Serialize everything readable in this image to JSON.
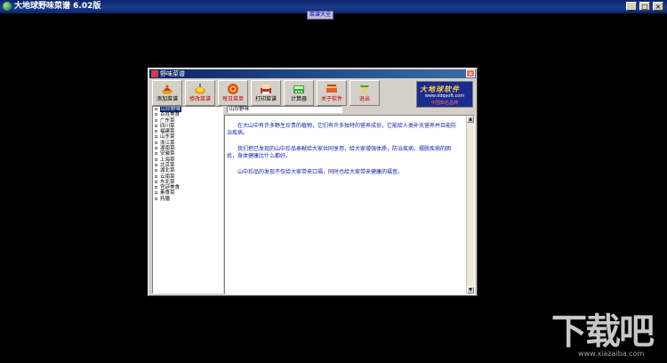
{
  "window": {
    "title": "大地球野味菜谱  6.02版",
    "buttons": [
      "_",
      "□",
      "×"
    ]
  },
  "menubar": {
    "item": "菜谱大全"
  },
  "dialog": {
    "title": "野味菜谱",
    "close": "×",
    "toolbar": [
      {
        "label": "添加菜谱",
        "icon": "add-recipe-icon",
        "color": "#000000"
      },
      {
        "label": "修改菜谱",
        "icon": "edit-recipe-icon",
        "color": "#c00000"
      },
      {
        "label": "每日菜单",
        "icon": "daily-menu-icon",
        "color": "#c00000"
      },
      {
        "label": "打印菜谱",
        "icon": "print-recipe-icon",
        "color": "#000000"
      },
      {
        "label": "计算器",
        "icon": "calculator-icon",
        "color": "#000000"
      },
      {
        "label": "关于软件",
        "icon": "about-icon",
        "color": "#c00000"
      },
      {
        "label": "退出",
        "icon": "exit-icon",
        "color": "#c00000"
      }
    ],
    "logo": {
      "top": "大地球软件",
      "url": "www.ddqsoft.com",
      "bottom": "中国知名品牌"
    },
    "tree": [
      "山珍野味",
      "百姓美食",
      "广东菜",
      "四川菜",
      "福建菜",
      "山东菜",
      "浙江菜",
      "湖南菜",
      "安徽菜",
      "上海菜",
      "北京菜",
      "湖北菜",
      "云南菜",
      "东北菜",
      "宫廷美食",
      "素食菜",
      "药膳"
    ],
    "selected_category": "山珍野味",
    "content": {
      "p1": "在大山中有许多野生珍贵的植物，它们有许多独特的营养成份，它能给人类补充营养并且能防治疾病。",
      "p2": "我们把已发现的山中珍品奉献给大家共同享用，给大家增强体质，防治疾病，摆脱疾病的困扰，身体健康比什么都好。",
      "p3": "山中珍品的发现不仅给大家带来口福，同时也给大家带来健康的福音。"
    }
  },
  "watermark": {
    "big": "下载吧",
    "small": "www.xiazaiba.com"
  }
}
